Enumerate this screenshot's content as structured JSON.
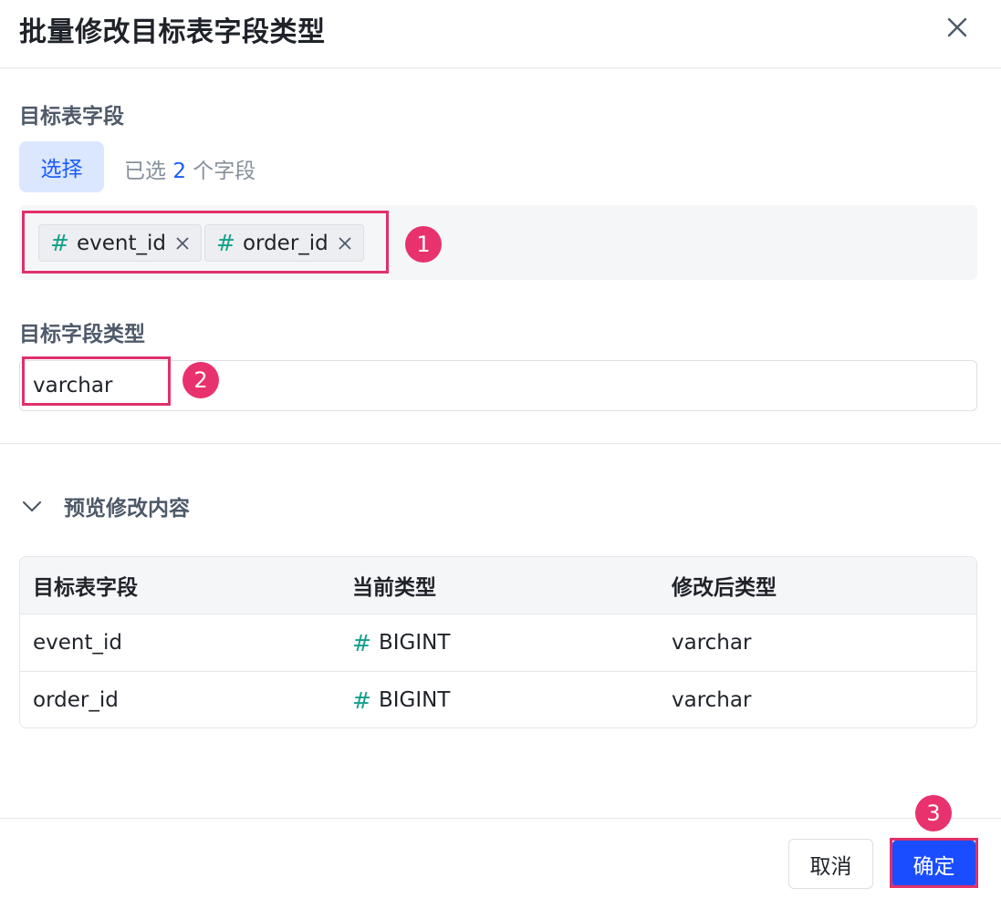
{
  "dialog": {
    "title": "批量修改目标表字段类型"
  },
  "target_fields": {
    "label": "目标表字段",
    "select_label": "选择",
    "selected_prefix": "已选",
    "selected_count": "2",
    "selected_suffix": "个字段",
    "tags": [
      {
        "label": "event_id",
        "icon": "hash-icon"
      },
      {
        "label": "order_id",
        "icon": "hash-icon"
      }
    ]
  },
  "field_type": {
    "label": "目标字段类型",
    "value": "varchar"
  },
  "preview": {
    "toggle_label": "预览修改内容",
    "columns": [
      "目标表字段",
      "当前类型",
      "修改后类型"
    ],
    "rows": [
      {
        "field": "event_id",
        "current": "BIGINT",
        "new": "varchar"
      },
      {
        "field": "order_id",
        "current": "BIGINT",
        "new": "varchar"
      }
    ]
  },
  "footer": {
    "cancel_label": "取消",
    "ok_label": "确定"
  },
  "annotations": [
    "1",
    "2",
    "3"
  ],
  "colors": {
    "accent": "#1a4dff",
    "highlight": "#e0306a",
    "hash": "#14a08a"
  }
}
